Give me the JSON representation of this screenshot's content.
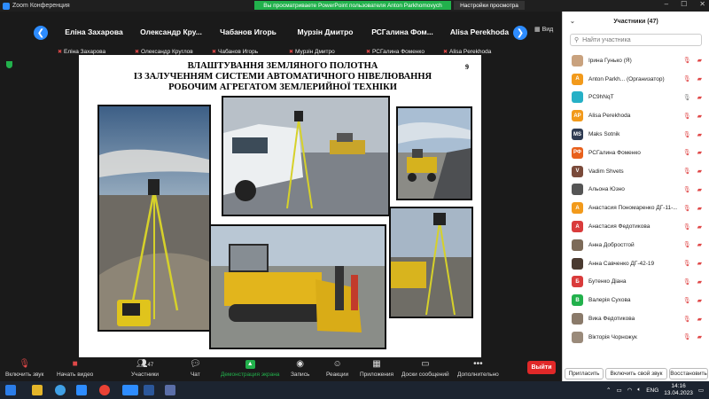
{
  "window": {
    "title": "Zoom Конференция",
    "share_banner": "Вы просматриваете PowerPoint пользователя Anton Parkhomovych",
    "view_settings": "Настройки просмотра",
    "view_label": "Вид"
  },
  "strip": {
    "tiles": [
      {
        "big": "Еліна Захарова",
        "small": "Еліна Захарова"
      },
      {
        "big": "Олександр  Кру...",
        "small": "Олександр Круглов"
      },
      {
        "big": "Чабанов Игорь",
        "small": "Чабанов Игорь"
      },
      {
        "big": "Мурзін Дмитро",
        "small": "Мурзін Дмитро"
      },
      {
        "big": "РСГалина  Фом...",
        "small": "РСГалина Фоменко"
      },
      {
        "big": "Alisa Perekhoda",
        "small": "Alisa Perekhoda"
      }
    ]
  },
  "slide": {
    "title_lines": [
      "ВЛАШТУВАННЯ ЗЕМЛЯНОГО ПОЛОТНА",
      "ІЗ ЗАЛУЧЕННЯМ СИСТЕМИ АВТОМАТИЧНОГО НІВЕЛЮВАННЯ",
      "РОБОЧИМ АГРЕГАТОМ ЗЕМЛЕРИЙНОЇ ТЕХНІКИ"
    ],
    "number": "9"
  },
  "panel": {
    "header": "Участники (47)",
    "search_placeholder": "Найти участника",
    "participants": [
      {
        "name": "Ірина Гунько (Я)",
        "initials": "",
        "color": "#c9a27e"
      },
      {
        "name": "Anton Parkh... (Организатор)",
        "initials": "A",
        "color": "#f29a1b"
      },
      {
        "name": "PC9hNqT",
        "initials": "",
        "color": "#26b0c6"
      },
      {
        "name": "Alisa Perekhoda",
        "initials": "AP",
        "color": "#f29a1b"
      },
      {
        "name": "Maks Sotnik",
        "initials": "MS",
        "color": "#2f3b52"
      },
      {
        "name": "РСГалина Фоменко",
        "initials": "РФ",
        "color": "#e8601c"
      },
      {
        "name": "Vadim Shvets",
        "initials": "V",
        "color": "#7a4a3a"
      },
      {
        "name": "Альона Юзно",
        "initials": "",
        "color": "#555555"
      },
      {
        "name": "Анастасия Пономаренко ДГ-11-...",
        "initials": "А",
        "color": "#f29a1b"
      },
      {
        "name": "Анастасия Федотикова",
        "initials": "А",
        "color": "#d93b3b"
      },
      {
        "name": "Анна Добростгой",
        "initials": "",
        "color": "#7c6a58"
      },
      {
        "name": "Анна Савченко ДГ-42-19",
        "initials": "",
        "color": "#4a3a30"
      },
      {
        "name": "Бутенко Діана",
        "initials": "Б",
        "color": "#d93b3b"
      },
      {
        "name": "Валерія Сухова",
        "initials": "В",
        "color": "#22b14c"
      },
      {
        "name": "Вика Федотикова",
        "initials": "",
        "color": "#8a7a6a"
      },
      {
        "name": "Вікторія Чорножук",
        "initials": "",
        "color": "#9a8a7a"
      }
    ],
    "footer": [
      "Пригласить",
      "Включить свой звук",
      "Восстановить"
    ]
  },
  "toolbar": {
    "unmute": "Включить звук",
    "video": "Начать видео",
    "participants": "Участники",
    "participants_count": "47",
    "chat": "Чат",
    "share": "Демонстрация экрана",
    "record": "Запись",
    "reactions": "Реакции",
    "apps": "Приложения",
    "whiteboards": "Доски сообщений",
    "more": "Дополнительно",
    "leave": "Выйти"
  },
  "taskbar": {
    "lang": "ENG",
    "time": "14:16",
    "date": "13.04.2023"
  }
}
